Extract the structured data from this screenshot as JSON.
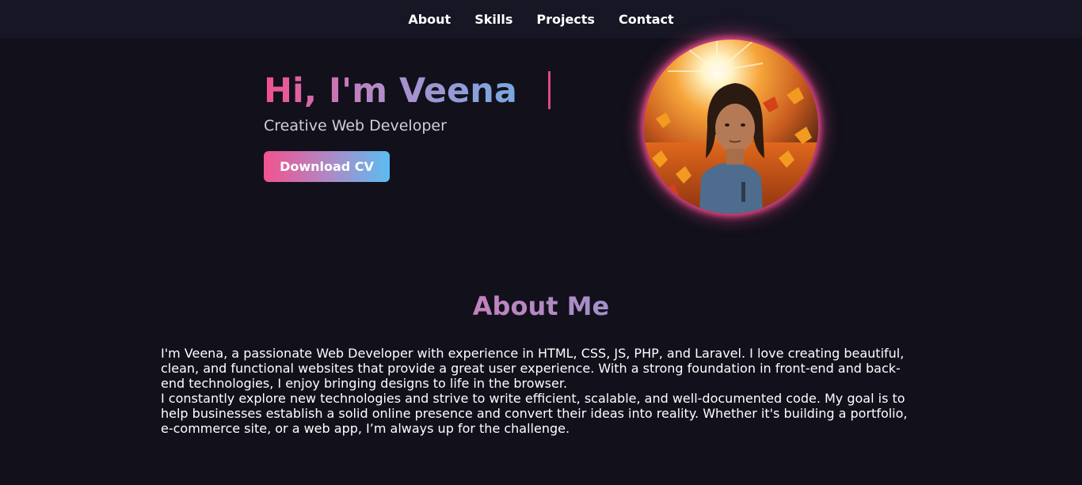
{
  "nav": {
    "items": [
      {
        "label": "About"
      },
      {
        "label": "Skills"
      },
      {
        "label": "Projects"
      },
      {
        "label": "Contact"
      }
    ]
  },
  "hero": {
    "title": "Hi, I'm Veena",
    "subtitle": "Creative Web Developer",
    "cv_button": "Download CV"
  },
  "about": {
    "heading": "About Me",
    "paragraph1": "I'm Veena, a passionate Web Developer with experience in HTML, CSS, JS, PHP, and Laravel. I love creating beautiful, clean, and functional websites that provide a great user experience. With a strong foundation in front-end and back-end technologies, I enjoy bringing designs to life in the browser.",
    "paragraph2": "I constantly explore new technologies and strive to write efficient, scalable, and well-documented code. My goal is to help businesses establish a solid online presence and convert their ideas into reality. Whether it's building a portfolio, e-commerce site, or a web app, I’m always up for the challenge."
  },
  "colors": {
    "background": "#11101b",
    "navbar": "#171624",
    "accent_pink": "#f0508f",
    "accent_blue": "#5bbcf1"
  }
}
